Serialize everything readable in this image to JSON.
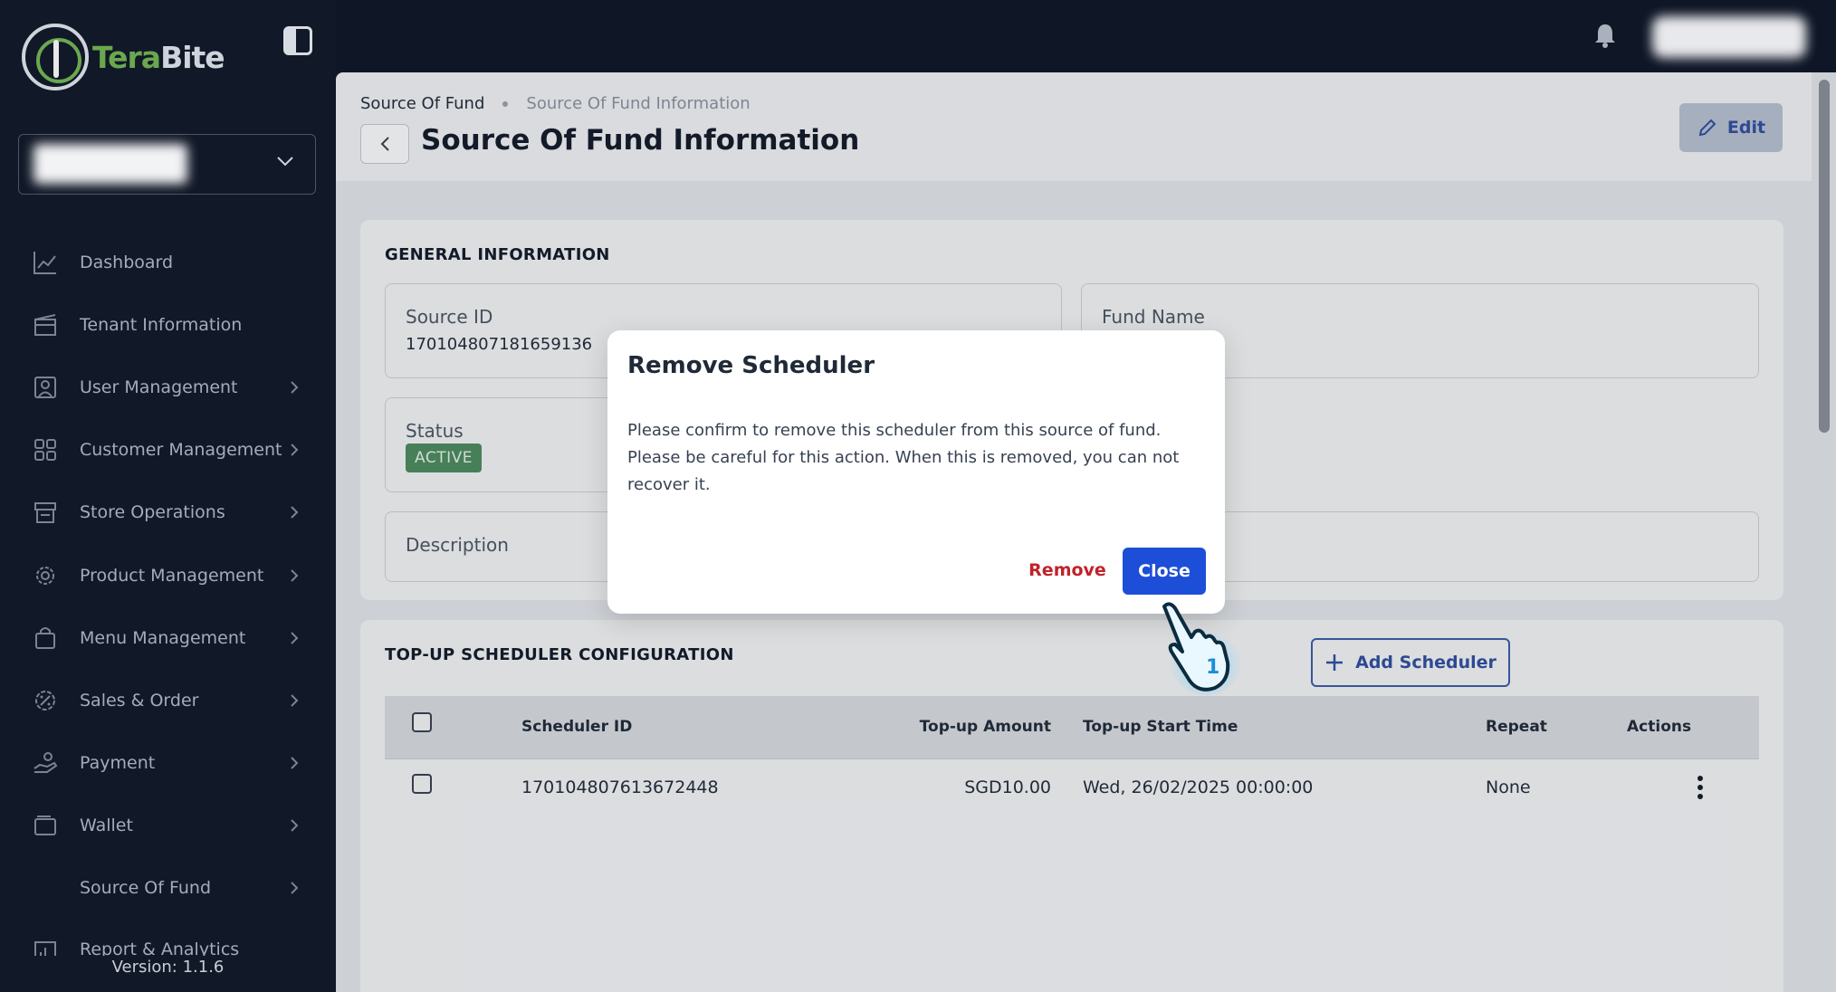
{
  "app": {
    "brand_part1": "Tera",
    "brand_part2": "Bite",
    "version": "Version: 1.1.6"
  },
  "sidebar": {
    "items": [
      {
        "label": "Dashboard",
        "icon": "chart-line-icon",
        "has_chevron": false
      },
      {
        "label": "Tenant Information",
        "icon": "building-icon",
        "has_chevron": false
      },
      {
        "label": "User Management",
        "icon": "user-card-icon",
        "has_chevron": true
      },
      {
        "label": "Customer Management",
        "icon": "grid-icon",
        "has_chevron": true
      },
      {
        "label": "Store Operations",
        "icon": "store-icon",
        "has_chevron": true
      },
      {
        "label": "Product Management",
        "icon": "gear-icon",
        "has_chevron": true
      },
      {
        "label": "Menu Management",
        "icon": "bag-icon",
        "has_chevron": true
      },
      {
        "label": "Sales & Order",
        "icon": "discount-icon",
        "has_chevron": true
      },
      {
        "label": "Payment",
        "icon": "hand-coin-icon",
        "has_chevron": true
      },
      {
        "label": "Wallet",
        "icon": "wallet-icon",
        "has_chevron": true
      },
      {
        "label": "Source Of Fund",
        "icon": "",
        "has_chevron": true
      },
      {
        "label": "Report & Analytics",
        "icon": "bar-chart-icon",
        "has_chevron": false
      }
    ]
  },
  "header": {
    "breadcrumb": [
      "Source Of Fund",
      "Source Of Fund Information"
    ],
    "title": "Source Of Fund Information",
    "edit_label": "Edit"
  },
  "general": {
    "section_title": "GENERAL INFORMATION",
    "source_id_label": "Source ID",
    "source_id_value": "170104807181659136",
    "fund_name_label": "Fund Name",
    "status_label": "Status",
    "status_value": "ACTIVE",
    "description_label": "Description"
  },
  "scheduler": {
    "section_title": "TOP-UP SCHEDULER CONFIGURATION",
    "add_label": "Add Scheduler",
    "columns": [
      "Scheduler ID",
      "Top-up Amount",
      "Top-up Start Time",
      "Repeat",
      "Actions"
    ],
    "rows": [
      {
        "id": "170104807613672448",
        "amount": "SGD10.00",
        "start": "Wed, 26/02/2025 00:00:00",
        "repeat": "None"
      }
    ]
  },
  "modal": {
    "title": "Remove Scheduler",
    "body": "Please confirm to remove this scheduler from this source of fund. Please be careful for this action. When this is removed, you can not recover it.",
    "remove_label": "Remove",
    "close_label": "Close"
  },
  "colors": {
    "sidebar_bg": "#111827",
    "brand_green": "#6aa84f",
    "primary": "#1d4ed8",
    "danger": "#c0222a",
    "status_active": "#4c8c5d"
  }
}
